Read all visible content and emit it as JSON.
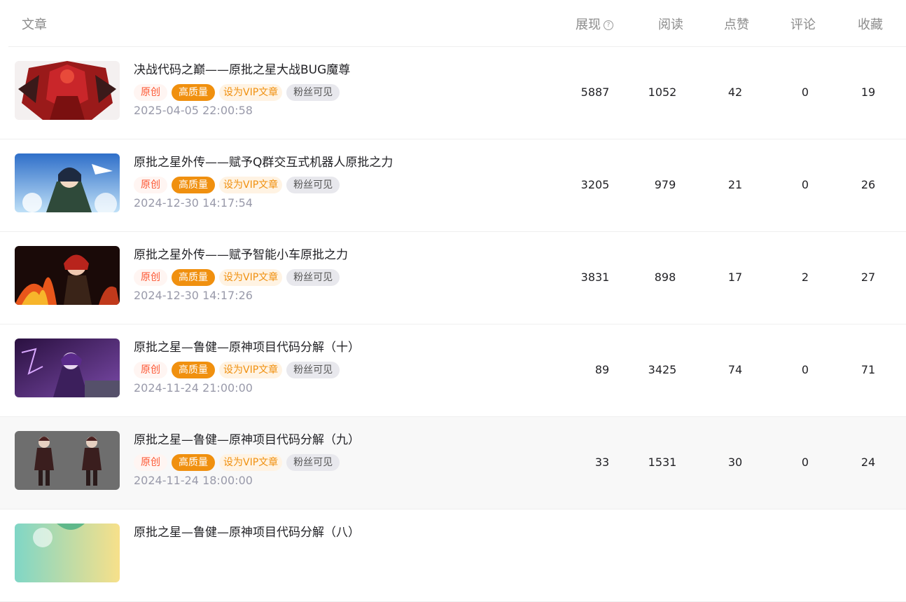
{
  "header": {
    "article": "文章",
    "impressions": "展现",
    "reads": "阅读",
    "likes": "点赞",
    "comments": "评论",
    "favorites": "收藏",
    "help_glyph": "?"
  },
  "tags": {
    "original": "原创",
    "high_quality": "高质量",
    "set_vip": "设为VIP文章",
    "fans_only": "粉丝可见"
  },
  "colors": {
    "original_tag": "#fc5531",
    "high_quality_bg": "#f0900f",
    "vip_text": "#f0900f",
    "fans_bg": "#e8e8ed",
    "hover_row_bg": "#f8f8f8"
  },
  "articles": [
    {
      "title": "决战代码之巅——原批之星大战BUG魔尊",
      "date": "2025-04-05 22:00:58",
      "impressions": "5887",
      "reads": "1052",
      "likes": "42",
      "comments": "0",
      "favorites": "19",
      "thumb": "red-character-art"
    },
    {
      "title": "原批之星外传——赋予Q群交互式机器人原批之力",
      "date": "2024-12-30 14:17:54",
      "impressions": "3205",
      "reads": "979",
      "likes": "21",
      "comments": "0",
      "favorites": "26",
      "thumb": "sky-character-art"
    },
    {
      "title": "原批之星外传——赋予智能小车原批之力",
      "date": "2024-12-30 14:17:26",
      "impressions": "3831",
      "reads": "898",
      "likes": "17",
      "comments": "2",
      "favorites": "27",
      "thumb": "fire-character-art"
    },
    {
      "title": "原批之星—鲁健—原神项目代码分解（十）",
      "date": "2024-11-24 21:00:00",
      "impressions": "89",
      "reads": "3425",
      "likes": "74",
      "comments": "0",
      "favorites": "71",
      "thumb": "purple-character-art"
    },
    {
      "title": "原批之星—鲁健—原神项目代码分解（九）",
      "date": "2024-11-24 18:00:00",
      "impressions": "33",
      "reads": "1531",
      "likes": "30",
      "comments": "0",
      "favorites": "24",
      "thumb": "grey-character-art"
    },
    {
      "title": "原批之星—鲁健—原神项目代码分解（八）",
      "thumb": "green-character-art"
    }
  ]
}
